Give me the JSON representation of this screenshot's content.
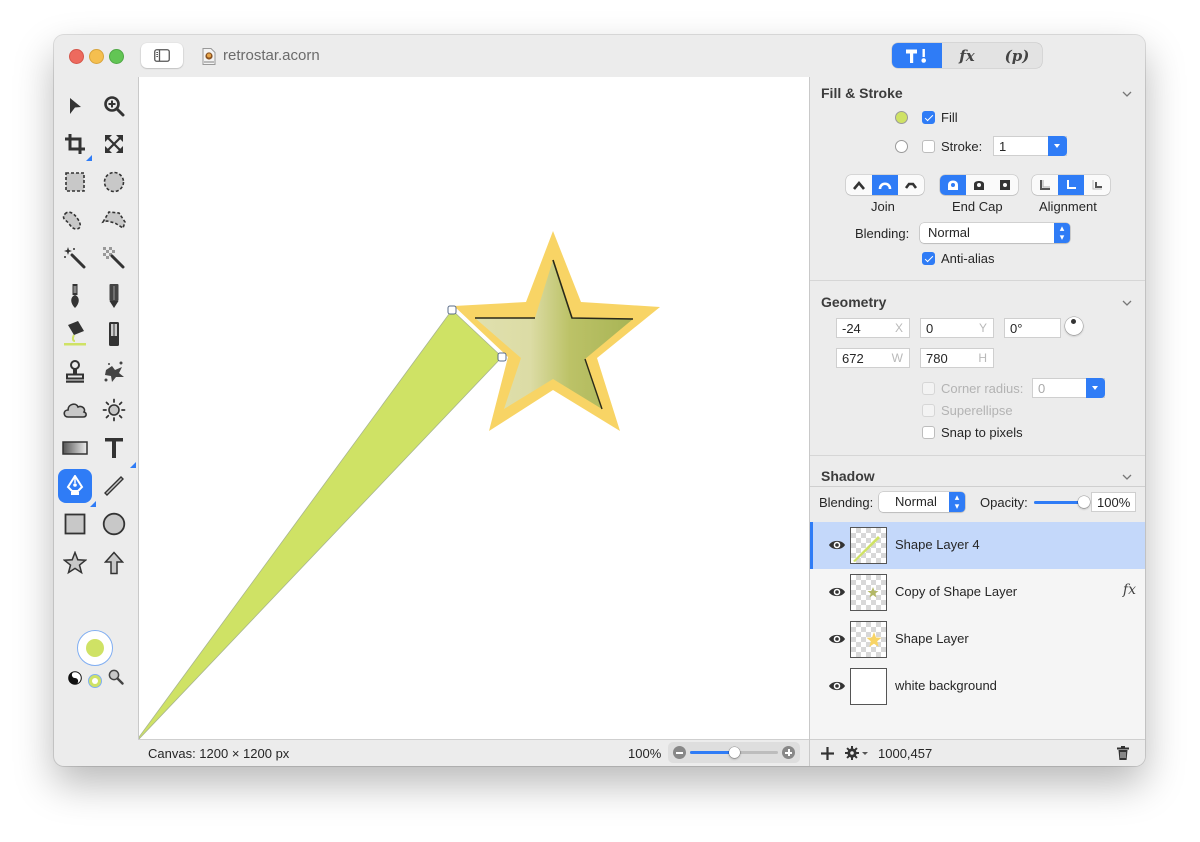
{
  "window": {
    "title": "retrostar.acorn",
    "palette_tabs": [
      {
        "name": "tools-tab",
        "label": "",
        "active": true
      },
      {
        "name": "filters-tab",
        "label": "fx",
        "active": false
      },
      {
        "name": "plugins-tab",
        "label": "(p)",
        "active": false
      }
    ]
  },
  "toolbox": {
    "tools": [
      {
        "name": "select-arrow-tool"
      },
      {
        "name": "zoom-tool"
      },
      {
        "name": "crop-tool"
      },
      {
        "name": "transform-tool"
      },
      {
        "name": "rect-select-tool"
      },
      {
        "name": "ellipse-select-tool"
      },
      {
        "name": "lasso-tool"
      },
      {
        "name": "polygon-lasso-tool"
      },
      {
        "name": "magic-wand-tool"
      },
      {
        "name": "color-select-tool"
      },
      {
        "name": "brush-tool"
      },
      {
        "name": "pencil-tool"
      },
      {
        "name": "paint-bucket-tool"
      },
      {
        "name": "eraser-tool"
      },
      {
        "name": "clone-stamp-tool"
      },
      {
        "name": "smudge-tool"
      },
      {
        "name": "cloud-tool"
      },
      {
        "name": "sun-tool"
      },
      {
        "name": "gradient-tool"
      },
      {
        "name": "text-tool"
      },
      {
        "name": "bezier-pen-tool",
        "selected": true
      },
      {
        "name": "line-tool"
      },
      {
        "name": "rectangle-shape-tool"
      },
      {
        "name": "oval-shape-tool"
      },
      {
        "name": "star-shape-tool"
      },
      {
        "name": "arrow-shape-tool"
      }
    ],
    "foreground_color": "#cfe265"
  },
  "canvas": {
    "status": "Canvas: 1200 × 1200 px",
    "zoom": "100%",
    "zoom_level_fraction": 0.5
  },
  "inspector": {
    "fill_stroke": {
      "title": "Fill & Stroke",
      "fill_label": "Fill",
      "fill_checked": true,
      "fill_color": "#cfe265",
      "stroke_label": "Stroke:",
      "stroke_checked": false,
      "stroke_color": "#ffffff",
      "stroke_width": "1",
      "join_label": "Join",
      "endcap_label": "End Cap",
      "alignment_label": "Alignment",
      "blending_label": "Blending:",
      "blending_value": "Normal",
      "antialias_label": "Anti-alias",
      "antialias_checked": true
    },
    "geometry": {
      "title": "Geometry",
      "x": "-24",
      "x_unit": "X",
      "y": "0",
      "y_unit": "Y",
      "rotation": "0°",
      "w": "672",
      "w_unit": "W",
      "h": "780",
      "h_unit": "H",
      "corner_radius_label": "Corner radius:",
      "corner_radius": "0",
      "superellipse_label": "Superellipse",
      "snap_label": "Snap to pixels"
    },
    "shadow": {
      "title": "Shadow",
      "blending_label": "Blending:",
      "blending_value": "Normal",
      "opacity_label": "Opacity:",
      "opacity": "100%",
      "opacity_fraction": 1.0
    },
    "layers": [
      {
        "name": "Shape Layer 4",
        "selected": true,
        "fx": false,
        "thumb": "streak"
      },
      {
        "name": "Copy of Shape Layer",
        "selected": false,
        "fx": true,
        "fx_label": "fx",
        "thumb": "small-star-green"
      },
      {
        "name": "Shape Layer",
        "selected": false,
        "fx": false,
        "thumb": "small-star-yellow"
      },
      {
        "name": "white background",
        "selected": false,
        "fx": false,
        "thumb": "white"
      }
    ],
    "coordinates": "1000,457"
  },
  "colors": {
    "accent": "#2f7cf6",
    "streak_green": "#cfe265",
    "star_outline": "#f8d465",
    "star_inner_light": "#e0e0ae",
    "star_inner_dark": "#a8b455"
  }
}
